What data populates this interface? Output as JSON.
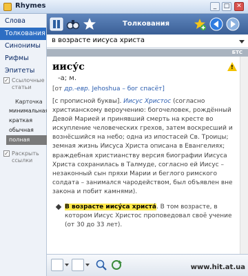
{
  "window": {
    "title": "Rhymes",
    "minimize_label": "_",
    "maximize_label": "□",
    "close_label": "✕"
  },
  "sidebar": {
    "items": [
      {
        "label": "Слова"
      },
      {
        "label": "Толкования"
      },
      {
        "label": "Синонимы"
      },
      {
        "label": "Рифмы"
      },
      {
        "label": "Эпитеты"
      }
    ],
    "active_index": 1,
    "show_links": {
      "label": "Ссылочные статьи",
      "checked": true
    },
    "card": {
      "label": "Карточка",
      "options": [
        {
          "label": "минимальная"
        },
        {
          "label": "краткая"
        },
        {
          "label": "обычная"
        },
        {
          "label": "полная"
        }
      ],
      "selected_index": 3
    },
    "expand_links": {
      "label": "Раскрыть ссылки",
      "checked": true
    }
  },
  "toolbar": {
    "title": "Толкования",
    "icons": [
      "book-icon",
      "binoculars-icon",
      "star-icon",
      "add-favorite-icon",
      "back-arrow-icon",
      "forward-arrow-icon"
    ]
  },
  "search": {
    "value": "в возрасте иисуса христа"
  },
  "source": {
    "tag": "БТС"
  },
  "entry": {
    "headword": "иису́с",
    "grammar": "-а;",
    "gender": "м.",
    "etymology": {
      "open": "[от ",
      "lang": "др.-евр.",
      "word": " Jehoshua",
      "meaning": " – бог спасёт]"
    },
    "definition": {
      "prefix": "[с прописной буквы]. ",
      "term": "Иисус Христос",
      "text": " (согласно христианскому вероучению: богочеловек, рождённый Девой Марией и принявший смерть на кресте во искупление человеческих грехов, затем воскресший и вознёсшийся на небо; одна из ипостасей Св. Троицы; земная жизнь Иисуса Христа описана в Евангелиях; враждебная христианству версия биографии Иисуса Христа сохранилась в Талмуде, согласно ей Иисус – незаконный сын пряхи Марии и беглого римского солдата – занимался чародейством, был объявлен вне закона и побит камнями)."
    },
    "phrase": {
      "text": "В возрасте иису́са христа́",
      "meaning": ". В том возрасте, в котором Иисус Христос проповедовал своё учение (от 30 до 33 лет)."
    }
  },
  "statusbar": {
    "watermark": "www.hit.at.ua",
    "icons": [
      "view-mode-icon",
      "display-icon",
      "zoom-icon",
      "refresh-icon"
    ]
  }
}
